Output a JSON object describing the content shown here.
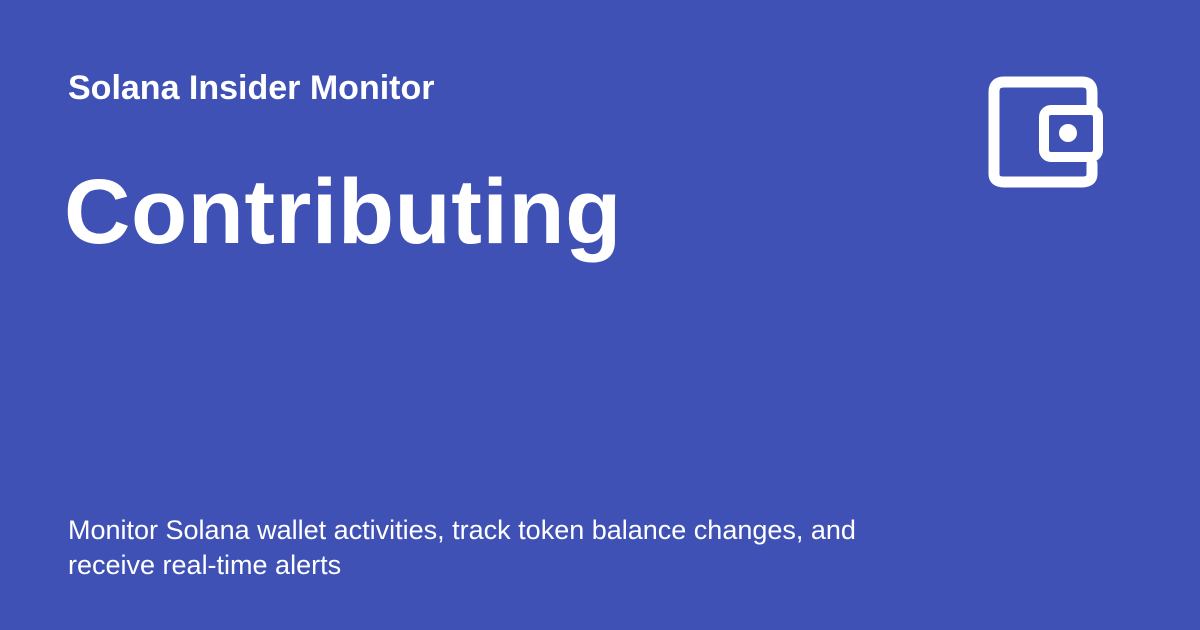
{
  "site": {
    "name": "Solana Insider Monitor",
    "logo_icon": "wallet-icon"
  },
  "page": {
    "title": "Contributing",
    "description": "Monitor Solana wallet activities, track token balance changes, and receive real-time alerts"
  },
  "colors": {
    "background": "#3f51b5",
    "foreground": "#ffffff"
  }
}
